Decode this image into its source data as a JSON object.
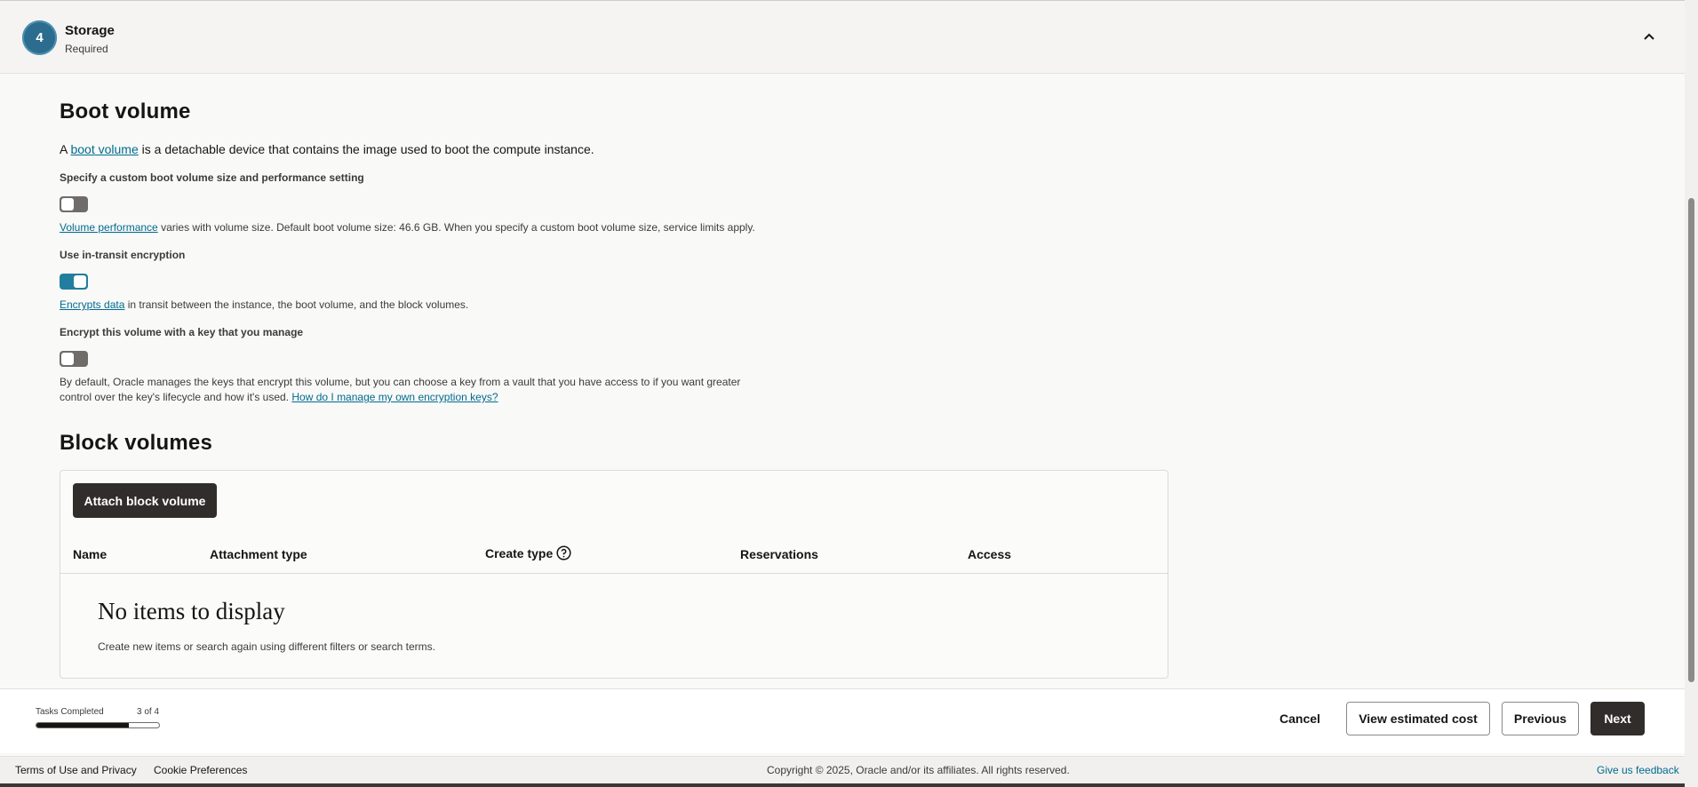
{
  "step": {
    "number": "4",
    "title": "Storage",
    "subtitle": "Required"
  },
  "boot_volume": {
    "heading": "Boot volume",
    "intro_prefix": "A ",
    "intro_link": "boot volume",
    "intro_suffix": " is a detachable device that contains the image used to boot the compute instance.",
    "custom_size": {
      "label": "Specify a custom boot volume size and performance setting",
      "enabled": false,
      "help_link": "Volume performance",
      "help_text": " varies with volume size. Default boot volume size: 46.6 GB. When you specify a custom boot volume size, service limits apply."
    },
    "in_transit": {
      "label": "Use in-transit encryption",
      "enabled": true,
      "help_link": "Encrypts data",
      "help_text": " in transit between the instance, the boot volume, and the block volumes."
    },
    "own_key": {
      "label": "Encrypt this volume with a key that you manage",
      "enabled": false,
      "help_line1": "By default, Oracle manages the keys that encrypt this volume, but you can choose a key from a vault that you have access to if you want greater",
      "help_line2": "control over the key's lifecycle and how it's used. ",
      "help_link": "How do I manage my own encryption keys?"
    }
  },
  "block_volumes": {
    "heading": "Block volumes",
    "attach_label": "Attach block volume",
    "columns": [
      "Name",
      "Attachment type",
      "Create type",
      "Reservations",
      "Access"
    ],
    "empty_title": "No items to display",
    "empty_text": "Create new items or search again using different filters or search terms."
  },
  "progress": {
    "label": "Tasks Completed",
    "count": "3 of 4",
    "fraction": 0.75
  },
  "actions": {
    "cancel": "Cancel",
    "estimate": "View estimated cost",
    "previous": "Previous",
    "next": "Next"
  },
  "footer": {
    "terms": "Terms of Use and Privacy",
    "cookies": "Cookie Preferences",
    "copyright": "Copyright © 2025, Oracle and/or its affiliates. All rights reserved.",
    "feedback": "Give us feedback"
  },
  "colors": {
    "accent": "#227e9e",
    "link": "#006b8f",
    "dark_button": "#312d2a"
  },
  "icons": {
    "collapse": "chevron-up-icon",
    "help": "question-circle-icon"
  }
}
